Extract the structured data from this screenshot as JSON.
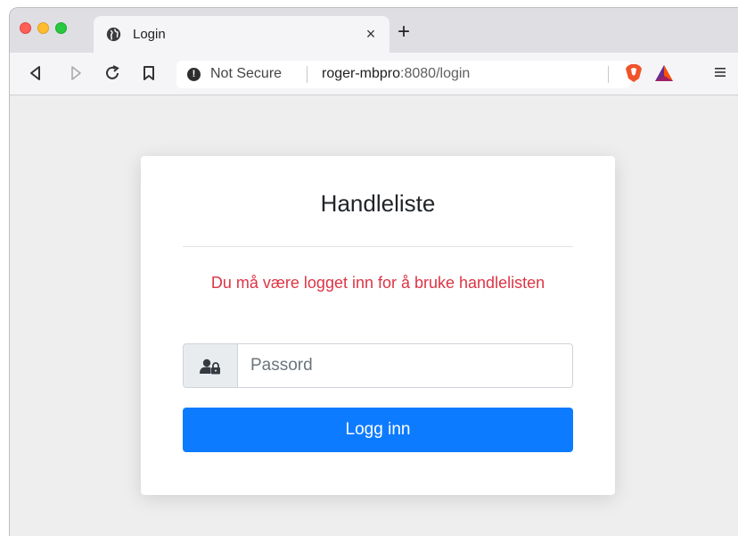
{
  "browser": {
    "tab": {
      "title": "Login",
      "icon": "globe-icon"
    },
    "new_tab_label": "+",
    "close_label": "×",
    "address": {
      "security_label": "Not Secure",
      "url_host": "roger-mbpro",
      "url_rest": ":8080/login"
    }
  },
  "card": {
    "title": "Handleliste",
    "message": "Du må være logget inn for å bruke handlelisten",
    "password_placeholder": "Passord",
    "login_button_label": "Logg inn"
  },
  "colors": {
    "accent": "#0d7bff",
    "error": "#dc3545"
  }
}
